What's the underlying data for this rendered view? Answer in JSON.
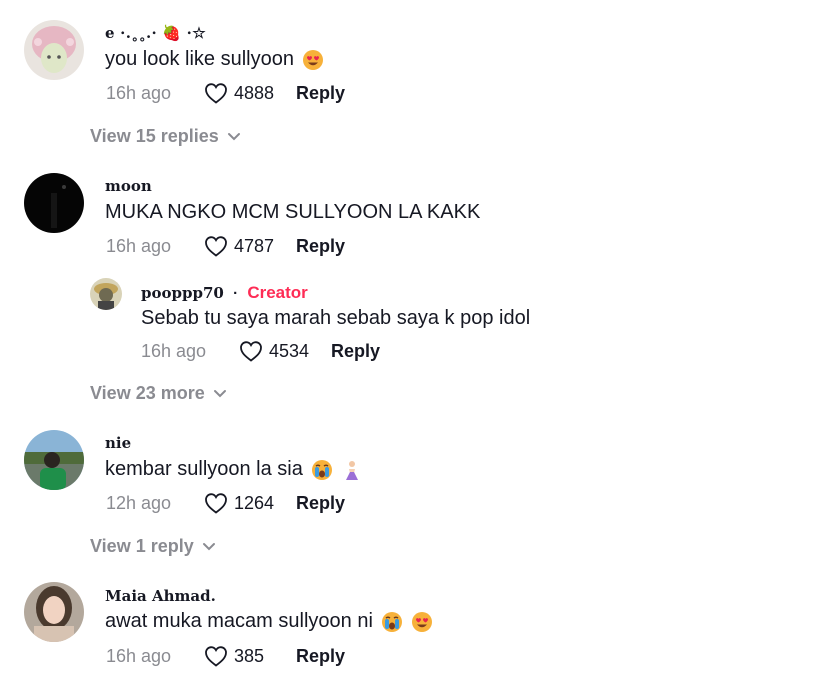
{
  "comments": [
    {
      "username": "e ⋅.˳˳.⋅ 🍓 ⋅☆",
      "text": "you look like sullyoon",
      "emojis": [
        "heart-eyes"
      ],
      "time": "16h ago",
      "likes": "4888",
      "reply_label": "Reply",
      "view_label": "View 15 replies"
    },
    {
      "username": "moon",
      "text": "MUKA NGKO MCM SULLYOON LA KAKK",
      "emojis": [],
      "time": "16h ago",
      "likes": "4787",
      "reply_label": "Reply",
      "reply_item": {
        "username": "pooppp70",
        "separator": "·",
        "badge": "Creator",
        "text": "Sebab tu saya marah sebab saya k pop idol",
        "time": "16h ago",
        "likes": "4534",
        "reply_label": "Reply"
      },
      "view_label": "View 23 more"
    },
    {
      "username": "nie",
      "text": "kembar sullyoon la sia",
      "emojis": [
        "crying-face",
        "dancer"
      ],
      "time": "12h ago",
      "likes": "1264",
      "reply_label": "Reply",
      "view_label": "View 1 reply"
    },
    {
      "username": "Maia Ahmad.",
      "text": "awat muka macam sullyoon ni",
      "emojis": [
        "crying-face",
        "heart-eyes"
      ],
      "time": "16h ago",
      "likes": "385",
      "reply_label": "Reply"
    }
  ],
  "colors": {
    "creator_badge": "#fe2c55",
    "muted_text": "#8a8b91",
    "primary_text": "#161823"
  }
}
